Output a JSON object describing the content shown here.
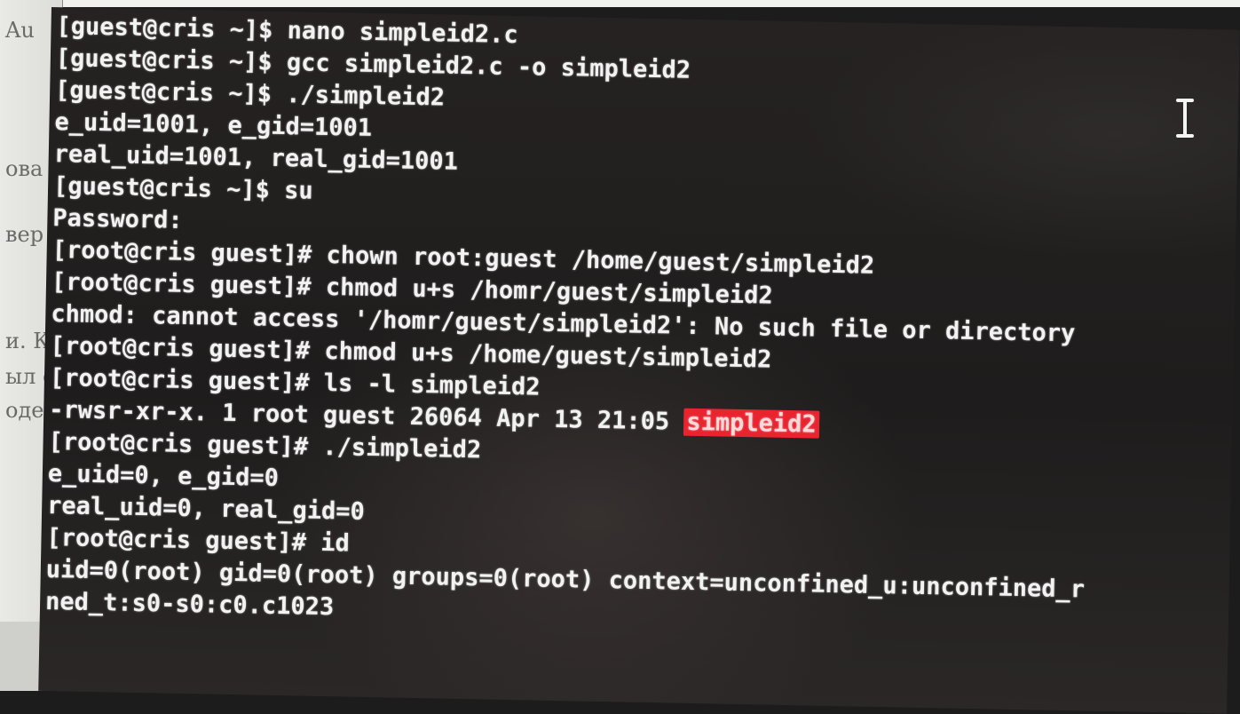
{
  "background_doc": {
    "fragments": [
      "Au",
      "ова",
      "вер",
      "и. К",
      "ыл с",
      "оде"
    ]
  },
  "terminal": {
    "lines": [
      "[guest@cris ~]$ nano simpleid2.c",
      "[guest@cris ~]$ gcc simpleid2.c -o simpleid2",
      "[guest@cris ~]$ ./simpleid2",
      "e_uid=1001, e_gid=1001",
      "real_uid=1001, real_gid=1001",
      "[guest@cris ~]$ su",
      "Password:",
      "[root@cris guest]# chown root:guest /home/guest/simpleid2",
      "[root@cris guest]# chmod u+s /homr/guest/simpleid2",
      "chmod: cannot access '/homr/guest/simpleid2': No such file or directory",
      "[root@cris guest]# chmod u+s /home/guest/simpleid2",
      "[root@cris guest]# ls -l simpleid2",
      "-rwsr-xr-x. 1 root guest 26064 Apr 13 21:05 ",
      "[root@cris guest]# ./simpleid2",
      "e_uid=0, e_gid=0",
      "real_uid=0, real_gid=0",
      "[root@cris guest]# id",
      "uid=0(root) gid=0(root) groups=0(root) context=unconfined_u:unconfined_r",
      "ned_t:s0-s0:c0.c1023"
    ],
    "highlighted_file": "simpleid2",
    "highlight_color": "#e8242f"
  }
}
